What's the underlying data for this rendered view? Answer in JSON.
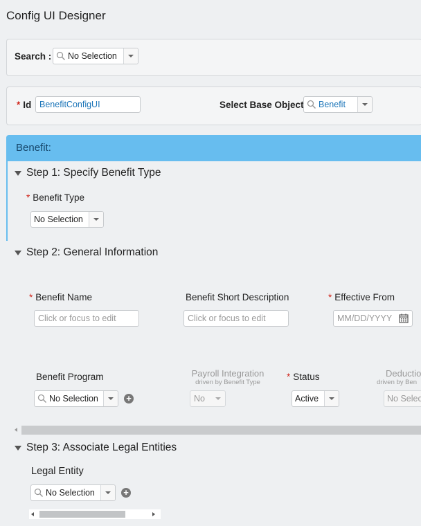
{
  "app": {
    "title": "Config UI Designer"
  },
  "search": {
    "label": "Search :",
    "value": "No Selection"
  },
  "id_row": {
    "id_label": "Id",
    "id_value": "BenefitConfigUI",
    "base_label": "Select Base Object",
    "base_value": "Benefit"
  },
  "section": {
    "title": "Benefit:"
  },
  "step1": {
    "title": "Step 1: Specify Benefit Type",
    "benefit_type_label": "Benefit Type",
    "benefit_type_value": "No Selection"
  },
  "step2": {
    "title": "Step 2: General Information",
    "benefit_name_label": "Benefit Name",
    "benefit_name_placeholder": "Click or focus to edit",
    "short_desc_label": "Benefit Short Description",
    "short_desc_placeholder": "Click or focus to edit",
    "effective_from_label": "Effective From",
    "effective_from_placeholder": "MM/DD/YYYY",
    "program_label": "Benefit Program",
    "program_value": "No Selection",
    "payroll_label": "Payroll Integration",
    "payroll_sub": "driven by Benefit Type",
    "payroll_value": "No",
    "status_label": "Status",
    "status_value": "Active",
    "deduction_label": "Deductio",
    "deduction_sub": "driven by Ben",
    "deduction_value": "No Selec"
  },
  "step3": {
    "title": "Step 3: Associate Legal Entities",
    "legal_entity_label": "Legal Entity",
    "legal_entity_value": "No Selection"
  },
  "icons": {
    "search": "magnifier-icon",
    "dropdown": "chevron-down-icon",
    "calendar": "calendar-icon",
    "add": "plus-circle-icon",
    "collapse": "triangle-down-icon"
  },
  "colors": {
    "header_bar": "#67bdef",
    "required": "#d0271d",
    "link_text": "#1a74b8"
  }
}
